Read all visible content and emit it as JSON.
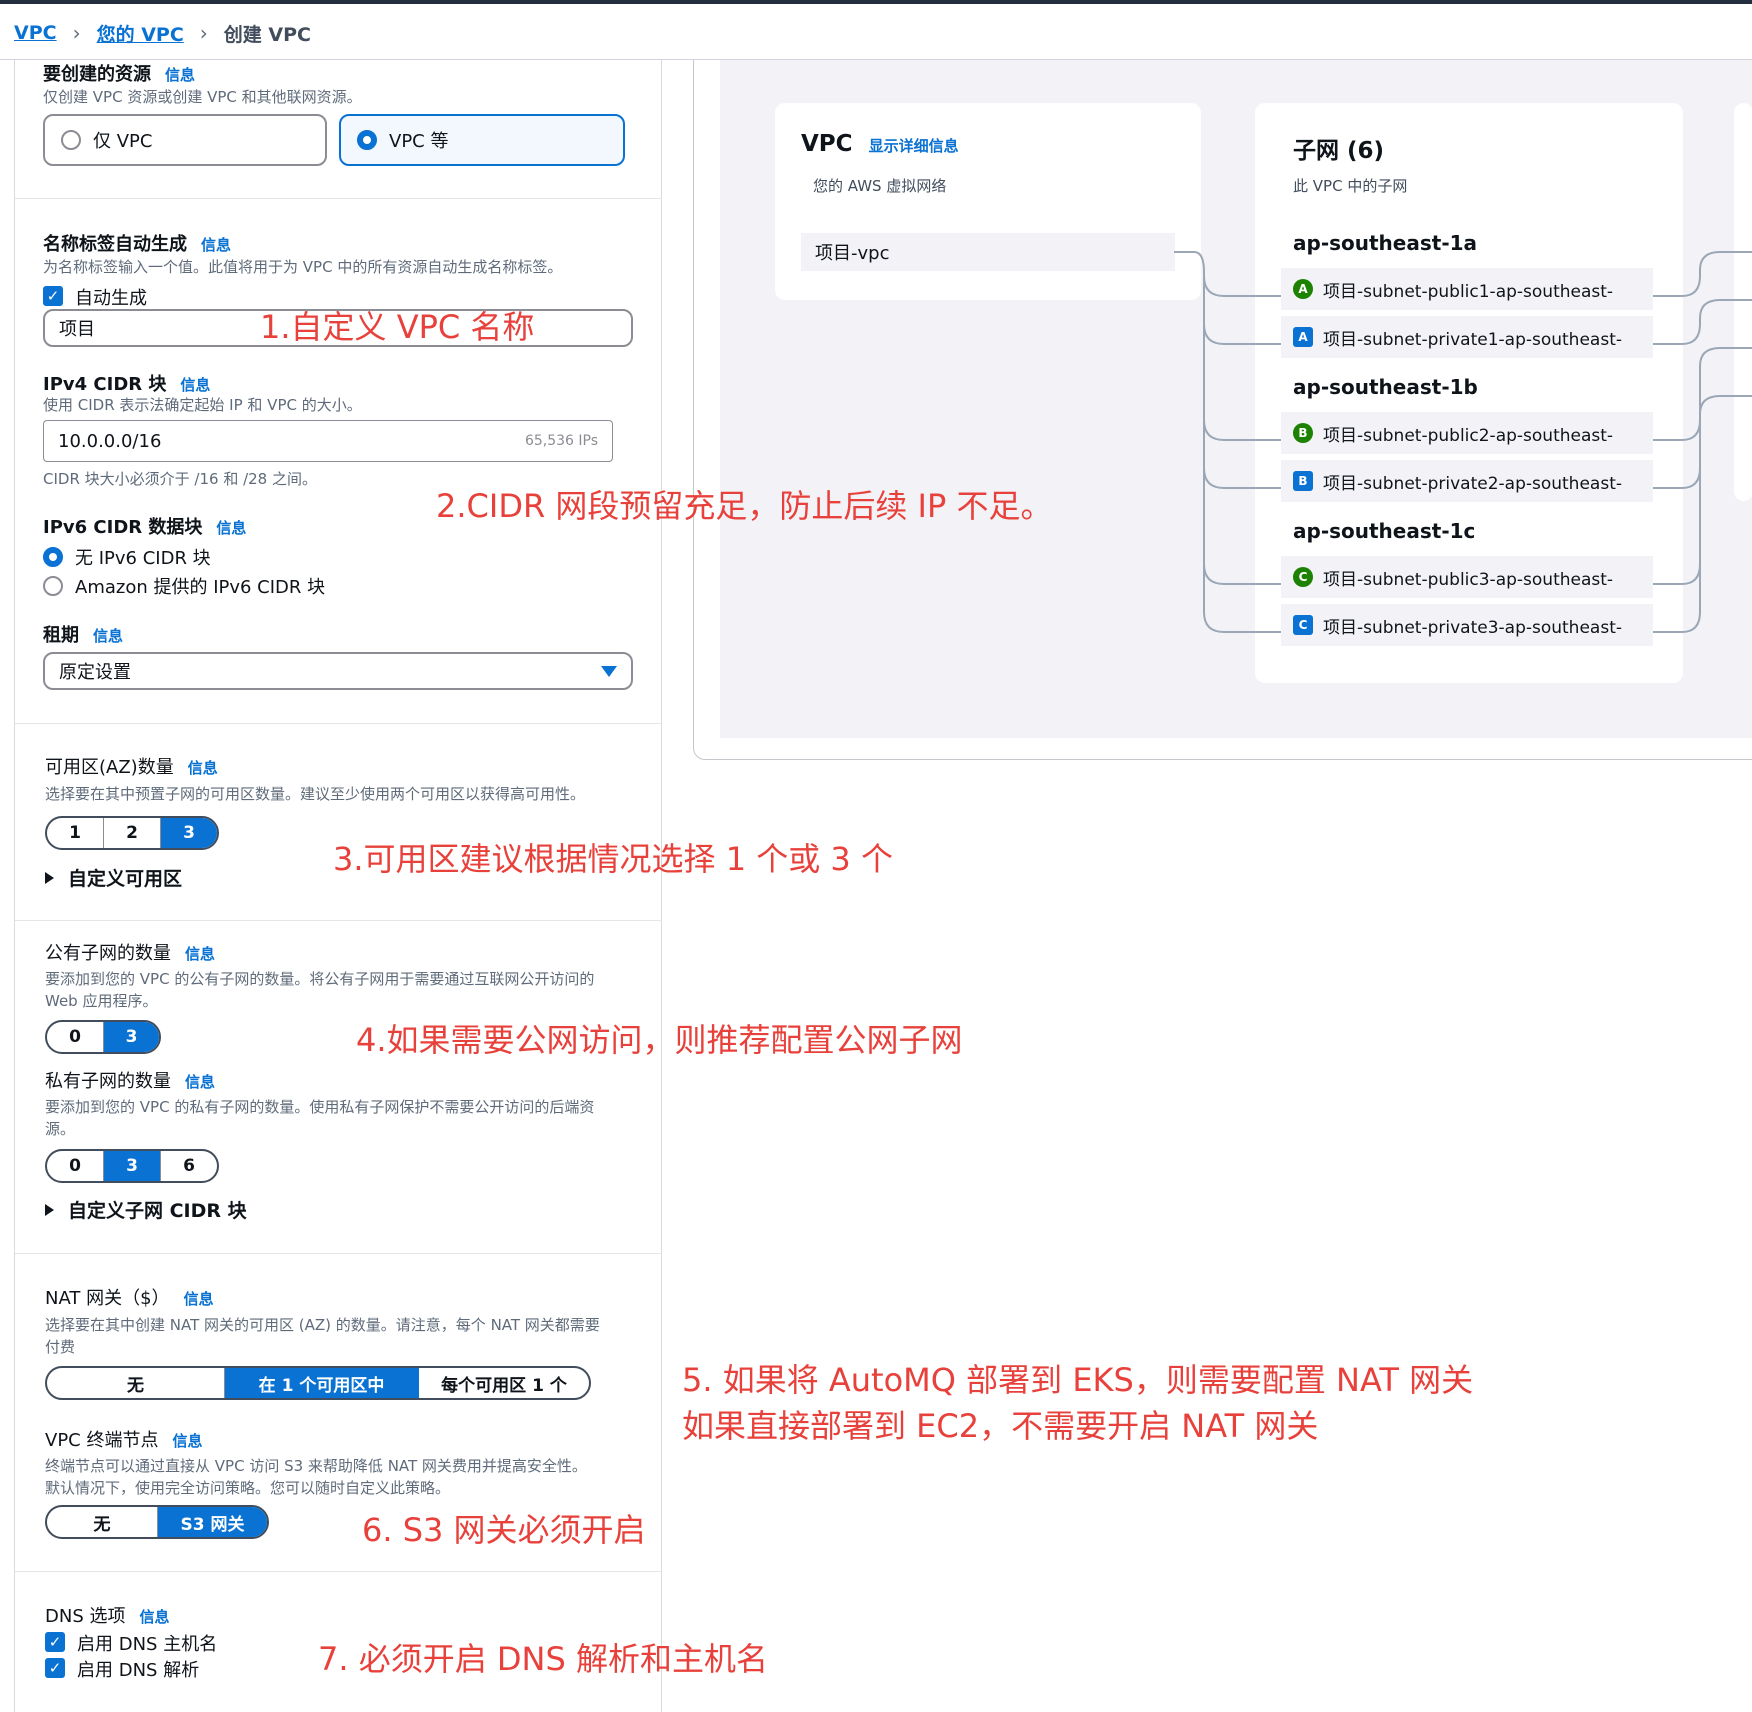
{
  "breadcrumb": {
    "root": "VPC",
    "parent": "您的 VPC",
    "current": "创建 VPC"
  },
  "info_label": "信息",
  "resources": {
    "label": "要创建的资源",
    "desc": "仅创建 VPC 资源或创建 VPC 和其他联网资源。",
    "option_vpc_only": "仅 VPC",
    "option_vpc_more": "VPC 等",
    "selected": "VPC 等"
  },
  "name_tag": {
    "label": "名称标签自动生成",
    "desc": "为名称标签输入一个值。此值将用于为 VPC 中的所有资源自动生成名称标签。",
    "auto_label": "自动生成",
    "value": "项目"
  },
  "ipv4": {
    "label": "IPv4 CIDR 块",
    "desc": "使用 CIDR 表示法确定起始 IP 和 VPC 的大小。",
    "value": "10.0.0.0/16",
    "hint": "65,536 IPs",
    "constraint": "CIDR 块大小必须介于 /16 和 /28 之间。"
  },
  "ipv6": {
    "label": "IPv6 CIDR 数据块",
    "option_none": "无 IPv6 CIDR 块",
    "option_amazon": "Amazon 提供的 IPv6 CIDR 块",
    "selected": "无 IPv6 CIDR 块"
  },
  "tenancy": {
    "label": "租期",
    "value": "原定设置"
  },
  "az": {
    "label": "可用区(AZ)数量",
    "desc": "选择要在其中预置子网的可用区数量。建议至少使用两个可用区以获得高可用性。",
    "options": [
      "1",
      "2",
      "3"
    ],
    "selected": "3",
    "customize": "自定义可用区"
  },
  "public_subnets": {
    "label": "公有子网的数量",
    "desc_line1": "要添加到您的 VPC 的公有子网的数量。将公有子网用于需要通过互联网公开访问的",
    "desc_line2": "Web 应用程序。",
    "options": [
      "0",
      "3"
    ],
    "selected": "3"
  },
  "private_subnets": {
    "label": "私有子网的数量",
    "desc_line1": "要添加到您的 VPC 的私有子网的数量。使用私有子网保护不需要公开访问的后端资",
    "desc_line2": "源。",
    "options": [
      "0",
      "3",
      "6"
    ],
    "selected": "3",
    "customize": "自定义子网 CIDR 块"
  },
  "nat": {
    "label": "NAT 网关（$）",
    "desc_line1": "选择要在其中创建 NAT 网关的可用区 (AZ) 的数量。请注意，每个 NAT 网关都需要",
    "desc_line2": "付费",
    "options": [
      "无",
      "在 1 个可用区中",
      "每个可用区 1 个"
    ],
    "selected": "在 1 个可用区中"
  },
  "endpoints": {
    "label": "VPC 终端节点",
    "desc_line1": "终端节点可以通过直接从 VPC 访问 S3 来帮助降低 NAT 网关费用并提高安全性。",
    "desc_line2": "默认情况下，使用完全访问策略。您可以随时自定义此策略。",
    "options": [
      "无",
      "S3 网关"
    ],
    "selected": "S3 网关"
  },
  "dns": {
    "label": "DNS 选项",
    "hostnames": "启用 DNS 主机名",
    "resolution": "启用 DNS 解析"
  },
  "annotations": {
    "n1": "1.自定义 VPC 名称",
    "n2": "2.CIDR 网段预留充足，防止后续 IP 不足。",
    "n3": "3.可用区建议根据情况选择 1 个或 3 个",
    "n4": "4.如果需要公网访问，则推荐配置公网子网",
    "n5a": "5. 如果将 AutoMQ 部署到 EKS，则需要配置 NAT 网关",
    "n5b": "如果直接部署到 EC2，不需要开启 NAT 网关",
    "n6": "6. S3 网关必须开启",
    "n7": "7. 必须开启 DNS 解析和主机名",
    "color": "#e8403a"
  },
  "preview": {
    "vpc": {
      "title": "VPC",
      "details_link": "显示详细信息",
      "subtitle": "您的 AWS 虚拟网络",
      "name": "项目-vpc"
    },
    "subnets": {
      "title": "子网 (6)",
      "subtitle": "此 VPC 中的子网",
      "zones": [
        {
          "name": "ap-southeast-1a",
          "items": [
            {
              "badge": "A",
              "type": "public",
              "name": "项目-subnet-public1-ap-southeast-"
            },
            {
              "badge": "A",
              "type": "private",
              "name": "项目-subnet-private1-ap-southeast-"
            }
          ]
        },
        {
          "name": "ap-southeast-1b",
          "items": [
            {
              "badge": "B",
              "type": "public",
              "name": "项目-subnet-public2-ap-southeast-"
            },
            {
              "badge": "B",
              "type": "private",
              "name": "项目-subnet-private2-ap-southeast-"
            }
          ]
        },
        {
          "name": "ap-southeast-1c",
          "items": [
            {
              "badge": "C",
              "type": "public",
              "name": "项目-subnet-public3-ap-southeast-"
            },
            {
              "badge": "C",
              "type": "private",
              "name": "项目-subnet-private3-ap-southeast-"
            }
          ]
        }
      ]
    }
  },
  "colors": {
    "accent": "#0972d3",
    "public_badge": "#1d8102",
    "annotation": "#e8403a"
  }
}
